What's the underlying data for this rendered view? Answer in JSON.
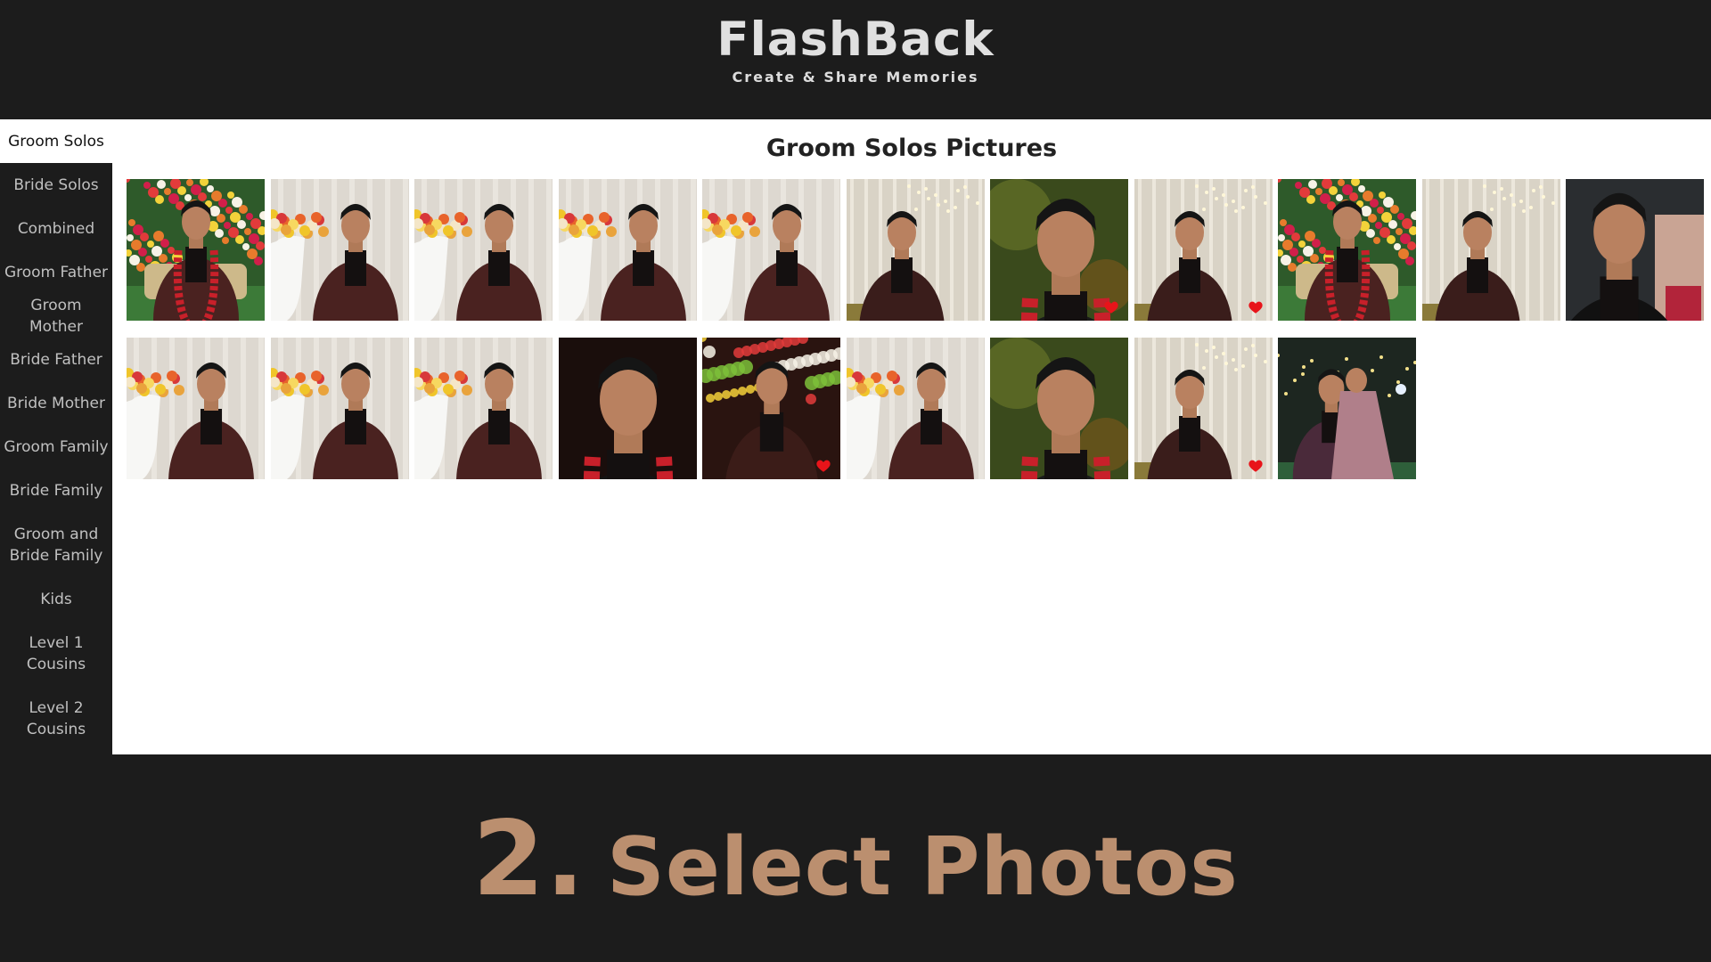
{
  "header": {
    "brand": "FlashBack",
    "tagline": "Create & Share Memories"
  },
  "sidebar": {
    "items": [
      {
        "label": "Groom Solos",
        "active": true
      },
      {
        "label": "Bride Solos"
      },
      {
        "label": "Combined"
      },
      {
        "label": "Groom Father"
      },
      {
        "label": "Groom Mother"
      },
      {
        "label": "Bride Father"
      },
      {
        "label": "Bride Mother"
      },
      {
        "label": "Groom Family"
      },
      {
        "label": "Bride Family"
      },
      {
        "label": "Groom and Bride Family"
      },
      {
        "label": "Kids"
      },
      {
        "label": "Level 1 Cousins"
      },
      {
        "label": "Level 2 Cousins"
      }
    ]
  },
  "main": {
    "title": "Groom Solos Pictures",
    "photos": [
      {
        "scene": "floral-seated",
        "favorite": false
      },
      {
        "scene": "flowers-vase",
        "favorite": false
      },
      {
        "scene": "flowers-vase",
        "favorite": false
      },
      {
        "scene": "flowers-vase",
        "favorite": false
      },
      {
        "scene": "flowers-vase",
        "favorite": false
      },
      {
        "scene": "curtain-standing",
        "favorite": false
      },
      {
        "scene": "closeup-green",
        "favorite": true
      },
      {
        "scene": "curtain-standing",
        "favorite": true
      },
      {
        "scene": "floral-seated",
        "favorite": false
      },
      {
        "scene": "curtain-standing",
        "favorite": false
      },
      {
        "scene": "dark-closeup",
        "favorite": false
      },
      {
        "scene": "flowers-vase",
        "favorite": false
      },
      {
        "scene": "flowers-vase",
        "favorite": false
      },
      {
        "scene": "flowers-vase",
        "favorite": false
      },
      {
        "scene": "dark-closeup-garland",
        "favorite": false
      },
      {
        "scene": "bokeh-dark",
        "favorite": true
      },
      {
        "scene": "flowers-vase",
        "favorite": false
      },
      {
        "scene": "closeup-green",
        "favorite": false
      },
      {
        "scene": "curtain-standing",
        "favorite": true
      },
      {
        "scene": "couple-night",
        "favorite": false
      }
    ]
  },
  "banner": {
    "step_number": "2.",
    "step_text": "Select Photos"
  },
  "colors": {
    "accent": "#bb8f6f",
    "heart": "#e8141a",
    "background": "#1c1c1c"
  }
}
